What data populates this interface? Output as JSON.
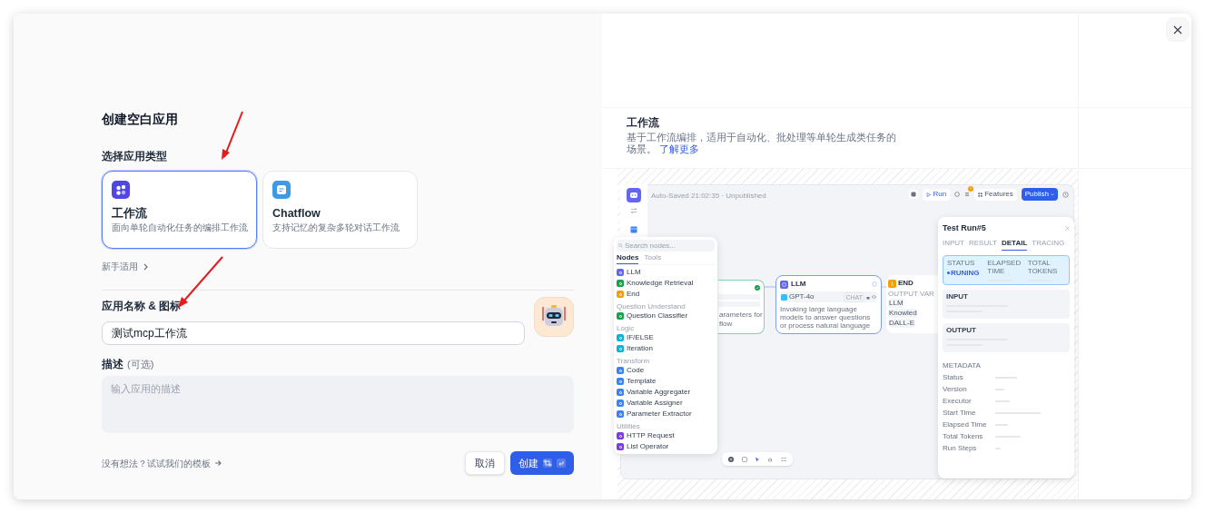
{
  "dialog": {
    "title": "创建空白应用",
    "type_label": "选择应用类型",
    "app_types": [
      {
        "kind": "workflow",
        "name": "工作流",
        "description": "面向单轮自动化任务的编排工作流",
        "selected": true
      },
      {
        "kind": "chatflow",
        "name": "Chatflow",
        "description": "支持记忆的复杂多轮对话工作流",
        "selected": false
      }
    ],
    "beginner_link": "新手适用",
    "name_label": "应用名称 & 图标",
    "name_value": "测试mcp工作流",
    "description_label": "描述",
    "description_optional": "(可选)",
    "description_placeholder": "输入应用的描述",
    "template_link": "没有想法？试试我们的模板",
    "cancel": "取消",
    "create": "创建"
  },
  "preview": {
    "title": "工作流",
    "description": "基于工作流编排，适用于自动化、批处理等单轮生成类任务的场景。",
    "learn_more": "了解更多",
    "screenshot": {
      "save_status": "Auto-Saved 21:02:35 · Unpublished",
      "run": "Run",
      "features": "Features",
      "publish": "Publish",
      "search_placeholder": "Search nodes...",
      "node_tabs": [
        {
          "label": "Nodes",
          "selected": true
        },
        {
          "label": "Tools",
          "selected": false
        }
      ],
      "node_groups": [
        {
          "items": [
            {
              "label": "LLM",
              "color": "#6366f1"
            },
            {
              "label": "Knowledge Retrieval",
              "color": "#16a34a"
            },
            {
              "label": "End",
              "color": "#f59e0b"
            }
          ]
        },
        {
          "heading": "Question Understand",
          "items": [
            {
              "label": "Question Classifier",
              "color": "#16a34a"
            }
          ]
        },
        {
          "heading": "Logic",
          "items": [
            {
              "label": "IF/ELSE",
              "color": "#06b6d4"
            },
            {
              "label": "Iteration",
              "color": "#06b6d4"
            }
          ]
        },
        {
          "heading": "Transform",
          "items": [
            {
              "label": "Code",
              "color": "#3b82f6"
            },
            {
              "label": "Template",
              "color": "#3b82f6"
            },
            {
              "label": "Variable Aggregater",
              "color": "#3b82f6"
            },
            {
              "label": "Variable Assigner",
              "color": "#3b82f6"
            },
            {
              "label": "Parameter Extractor",
              "color": "#3b82f6"
            }
          ]
        },
        {
          "heading": "Utilities",
          "items": [
            {
              "label": "HTTP Request",
              "color": "#7c3aed"
            },
            {
              "label": "List Operator",
              "color": "#7c3aed"
            }
          ]
        }
      ],
      "start_node": {
        "text_lines": [
          "arameters for",
          "flow"
        ]
      },
      "llm_node": {
        "title": "LLM",
        "model": "GPT-4o",
        "mode": "CHAT",
        "description": "Invoking large language models to answer questions or process natural language"
      },
      "end_node": {
        "title": "END",
        "output_label": "OUTPUT VAR",
        "outputs": [
          "LLM",
          "Knowled",
          "DALL-E"
        ]
      },
      "test_run": {
        "title": "Test Run#5",
        "tabs": [
          {
            "label": "INPUT",
            "selected": false
          },
          {
            "label": "RESULT",
            "selected": false
          },
          {
            "label": "DETAIL",
            "selected": true
          },
          {
            "label": "TRACING",
            "selected": false
          }
        ],
        "status_label": "STATUS",
        "status": "RUNING",
        "elapsed_label": "ELAPSED TIME",
        "tokens_label": "TOTAL TOKENS",
        "input_label": "INPUT",
        "output_label": "OUTPUT",
        "metadata_label": "METADATA",
        "metadata": [
          "Status",
          "Version",
          "Executor",
          "Start Time",
          "Elapsed Time",
          "Total Tokens",
          "Run Steps"
        ]
      }
    }
  }
}
